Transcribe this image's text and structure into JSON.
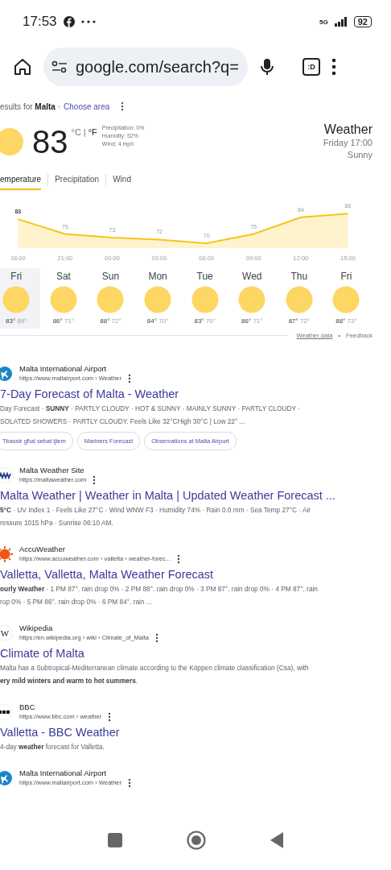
{
  "status_bar": {
    "time": "17:53",
    "network": "5G",
    "battery": "92"
  },
  "toolbar": {
    "url": "google.com/search?q=",
    "tab_count": ":D"
  },
  "location_line": {
    "prefix": "esults for",
    "place": "Malta",
    "separator": "·",
    "link": "Choose area"
  },
  "weather": {
    "temperature": "83",
    "unit_c": "°C",
    "unit_sep": "|",
    "unit_f": "°F",
    "details": [
      "Precipitation: 0%",
      "Humidity: 52%",
      "Wind: 4 mph"
    ],
    "title": "Weather",
    "when": "Friday 17:00",
    "condition": "Sunny",
    "tabs": [
      {
        "label": "emperature",
        "selected": true
      },
      {
        "label": "Precipitation",
        "selected": false
      },
      {
        "label": "Wind",
        "selected": false
      }
    ],
    "chart_data": {
      "type": "area",
      "categories": [
        "18:00",
        "21:00",
        "00:00",
        "03:00",
        "06:00",
        "09:00",
        "12:00",
        "15:00"
      ],
      "values": [
        83,
        75,
        73,
        72,
        70,
        75,
        84,
        86
      ],
      "data_labels": true
    },
    "days": [
      {
        "day": "Fri",
        "high": "83°",
        "low": "69°",
        "selected": true
      },
      {
        "day": "Sat",
        "high": "86°",
        "low": "71°",
        "selected": false
      },
      {
        "day": "Sun",
        "high": "88°",
        "low": "72°",
        "selected": false
      },
      {
        "day": "Mon",
        "high": "84°",
        "low": "70°",
        "selected": false
      },
      {
        "day": "Tue",
        "high": "83°",
        "low": "70°",
        "selected": false
      },
      {
        "day": "Wed",
        "high": "86°",
        "low": "71°",
        "selected": false
      },
      {
        "day": "Thu",
        "high": "87°",
        "low": "72°",
        "selected": false
      },
      {
        "day": "Fri",
        "high": "88°",
        "low": "73°",
        "selected": false
      }
    ],
    "footer_link": "Weather data",
    "footer_sep": "•",
    "footer_feedback": "Feedback"
  },
  "results": [
    {
      "favicon": {
        "kind": "airport"
      },
      "site": "Malta International Airport",
      "url": "https://www.maltairport.com › Weather",
      "title": "7-Day Forecast of Malta - Weather",
      "snippet_lines": [
        "Day Forecast · **SUNNY** · PARTLY CLOUDY · HOT & SUNNY · MAINLY SUNNY · PARTLY CLOUDY ·",
        "SOLATED SHOWERS · PARTLY CLOUDY. Feels Like 32°CHigh 30°C | Low 22° ..."
      ],
      "chips": [
        "Tbassir għal sebat ijiem",
        "Mariners Forecast",
        "Observations at Malta Airport"
      ]
    },
    {
      "favicon": {
        "kind": "maltaweather"
      },
      "site": "Malta Weather Site",
      "url": "https://maltaweather.com",
      "title": "Malta Weather | Weather in Malta | Updated Weather Forecast ...",
      "snippet_lines": [
        "**5°C** · UV Index 1 · Feels Like 27°C · Wind WNW F3 · Humidity 74% · Rain 0.0 mm · Sea Temp 27°C · Air",
        "ressure 1015 hPa · Sunrise 06:10 AM."
      ]
    },
    {
      "favicon": {
        "kind": "accuweather"
      },
      "site": "AccuWeather",
      "url": "https://www.accuweather.com › valletta › weather-forec...",
      "title": "Valletta, Valletta, Malta Weather Forecast",
      "snippet_lines": [
        "**ourly Weather** · 1 PM 87°. rain drop 0% · 2 PM 88°. rain drop 0% · 3 PM 87°. rain drop 0% · 4 PM 87°. rain",
        "rop 0% · 5 PM 86°. rain drop 0% · 6 PM 84°. rain ..."
      ]
    },
    {
      "favicon": {
        "kind": "wikipedia",
        "text": "W"
      },
      "site": "Wikipedia",
      "url": "https://en.wikipedia.org › wiki › Climate_of_Malta",
      "title": "Climate of Malta",
      "snippet_lines": [
        "Malta has a Subtropical-Mediterranean climate according to the Köppen climate classification (Csa), with",
        "**ery mild winters and warm to hot summers**."
      ]
    },
    {
      "favicon": {
        "kind": "bbc"
      },
      "site": "BBC",
      "url": "https://www.bbc.com › weather",
      "title": "Valletta - BBC Weather",
      "snippet_lines": [
        "4-day **weather** forecast for Valletta."
      ]
    },
    {
      "favicon": {
        "kind": "airport"
      },
      "site": "Malta International Airport",
      "url": "https://www.maltairport.com › Weather"
    }
  ]
}
